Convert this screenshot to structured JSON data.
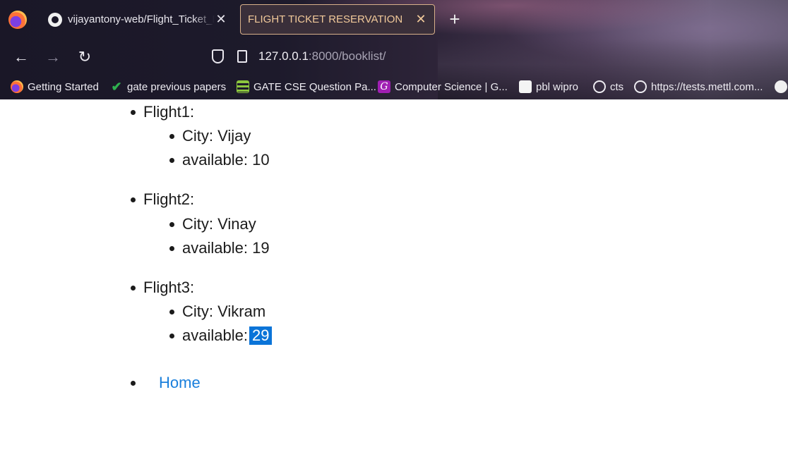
{
  "browser": {
    "tabs": [
      {
        "title": "vijayantony-web/Flight_Ticket_B",
        "close": "✕",
        "active": false
      },
      {
        "title": "FLIGHT TICKET RESERVATION",
        "close": "✕",
        "active": true
      }
    ],
    "new_tab": "+",
    "nav": {
      "back": "←",
      "forward": "→",
      "reload": "↻"
    },
    "url": {
      "host": "127.0.0.1",
      "rest": ":8000/booklist/"
    },
    "bookmarks": [
      {
        "label": "Getting Started",
        "icon": "firefox-icon"
      },
      {
        "label": "gate previous papers",
        "icon": "checkmark-icon"
      },
      {
        "label": "GATE CSE Question Pa...",
        "icon": "stack-icon"
      },
      {
        "label": "Computer Science | G...",
        "icon": "g-icon"
      },
      {
        "label": "pbl wipro",
        "icon": "pbl-icon"
      },
      {
        "label": "cts",
        "icon": "globe-icon"
      },
      {
        "label": "https://tests.mettl.com...",
        "icon": "globe-icon"
      },
      {
        "label": "",
        "icon": "github-icon"
      }
    ]
  },
  "page": {
    "flights": [
      {
        "name": "Flight1:",
        "city": "City: Vijay",
        "available_label": "available:",
        "available": "10"
      },
      {
        "name": "Flight2:",
        "city": "City: Vinay",
        "available_label": "available:",
        "available": "19"
      },
      {
        "name": "Flight3:",
        "city": "City: Vikram",
        "available_label": "available:",
        "available": "29"
      }
    ],
    "home_link": "Home"
  }
}
